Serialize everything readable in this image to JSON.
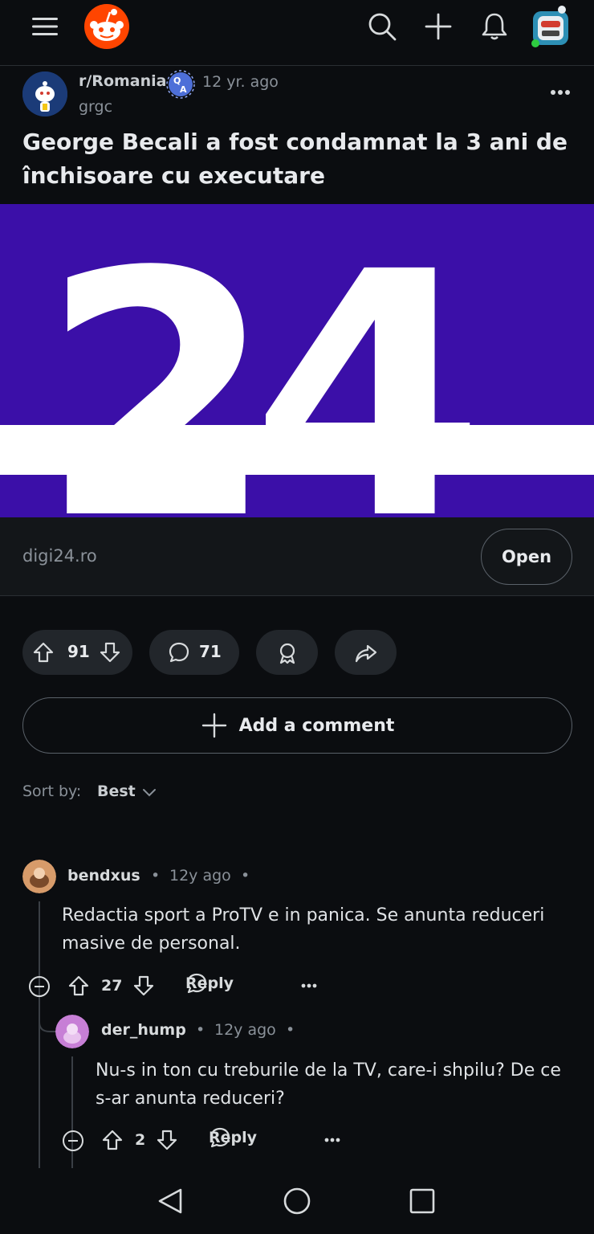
{
  "topbar": {
    "icons": [
      "menu-icon",
      "reddit-logo-icon",
      "search-icon",
      "plus-icon",
      "bell-icon",
      "user-avatar-icon"
    ]
  },
  "post": {
    "subreddit": "r/Romania",
    "time": "12 yr. ago",
    "author": "grgc",
    "title": "George Becali a fost condamnat la 3 ani de închisoare cu executare",
    "image_text": "24",
    "link_domain": "digi24.ro",
    "open_label": "Open",
    "votes": "91",
    "comments": "71"
  },
  "add_comment": {
    "label": "Add a comment"
  },
  "sort": {
    "label": "Sort by:",
    "value": "Best"
  },
  "comments": [
    {
      "user": "bendxus",
      "time": "12y ago",
      "body": "Redactia sport a ProTV e in panica. Se anunta reduceri masive de personal.",
      "votes": "27",
      "reply_label": "Reply"
    },
    {
      "user": "der_hump",
      "time": "12y ago",
      "body": "Nu-s in ton cu treburile de la TV, care-i shpilu? De ce s-ar anunta reduceri?",
      "votes": "2",
      "reply_label": "Reply"
    }
  ],
  "colors": {
    "background": "#0b0d10",
    "hero_purple": "#3b0fa8",
    "reddit_orange": "#ff4500",
    "pill_bg": "#22262b"
  }
}
